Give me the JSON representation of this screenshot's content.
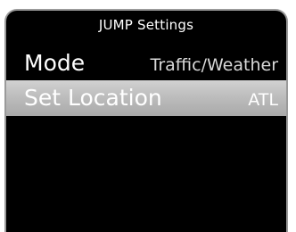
{
  "screen": {
    "title": "JUMP Settings"
  },
  "menu": {
    "items": [
      {
        "label": "Mode",
        "value": "Traffic/Weather",
        "selected": false
      },
      {
        "label": "Set Location",
        "value": "ATL",
        "selected": true
      }
    ]
  },
  "colors": {
    "background": "#000000",
    "highlight": "#bdbdbd",
    "text": "#ffffff",
    "bezel_border": "#9a9a9a"
  }
}
